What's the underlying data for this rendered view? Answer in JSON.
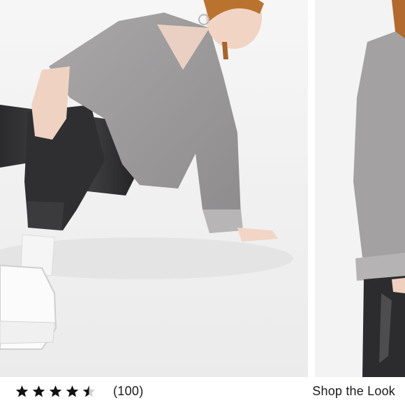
{
  "product": {
    "images": [
      {
        "alt": ""
      },
      {
        "alt": ""
      }
    ]
  },
  "rating": {
    "value": 4.5,
    "max": 5,
    "count_label": "(100)",
    "star_color": "#111111",
    "empty_star_color": "#cfcfcf"
  },
  "shop_the_look": {
    "label": "Shop the Look"
  }
}
